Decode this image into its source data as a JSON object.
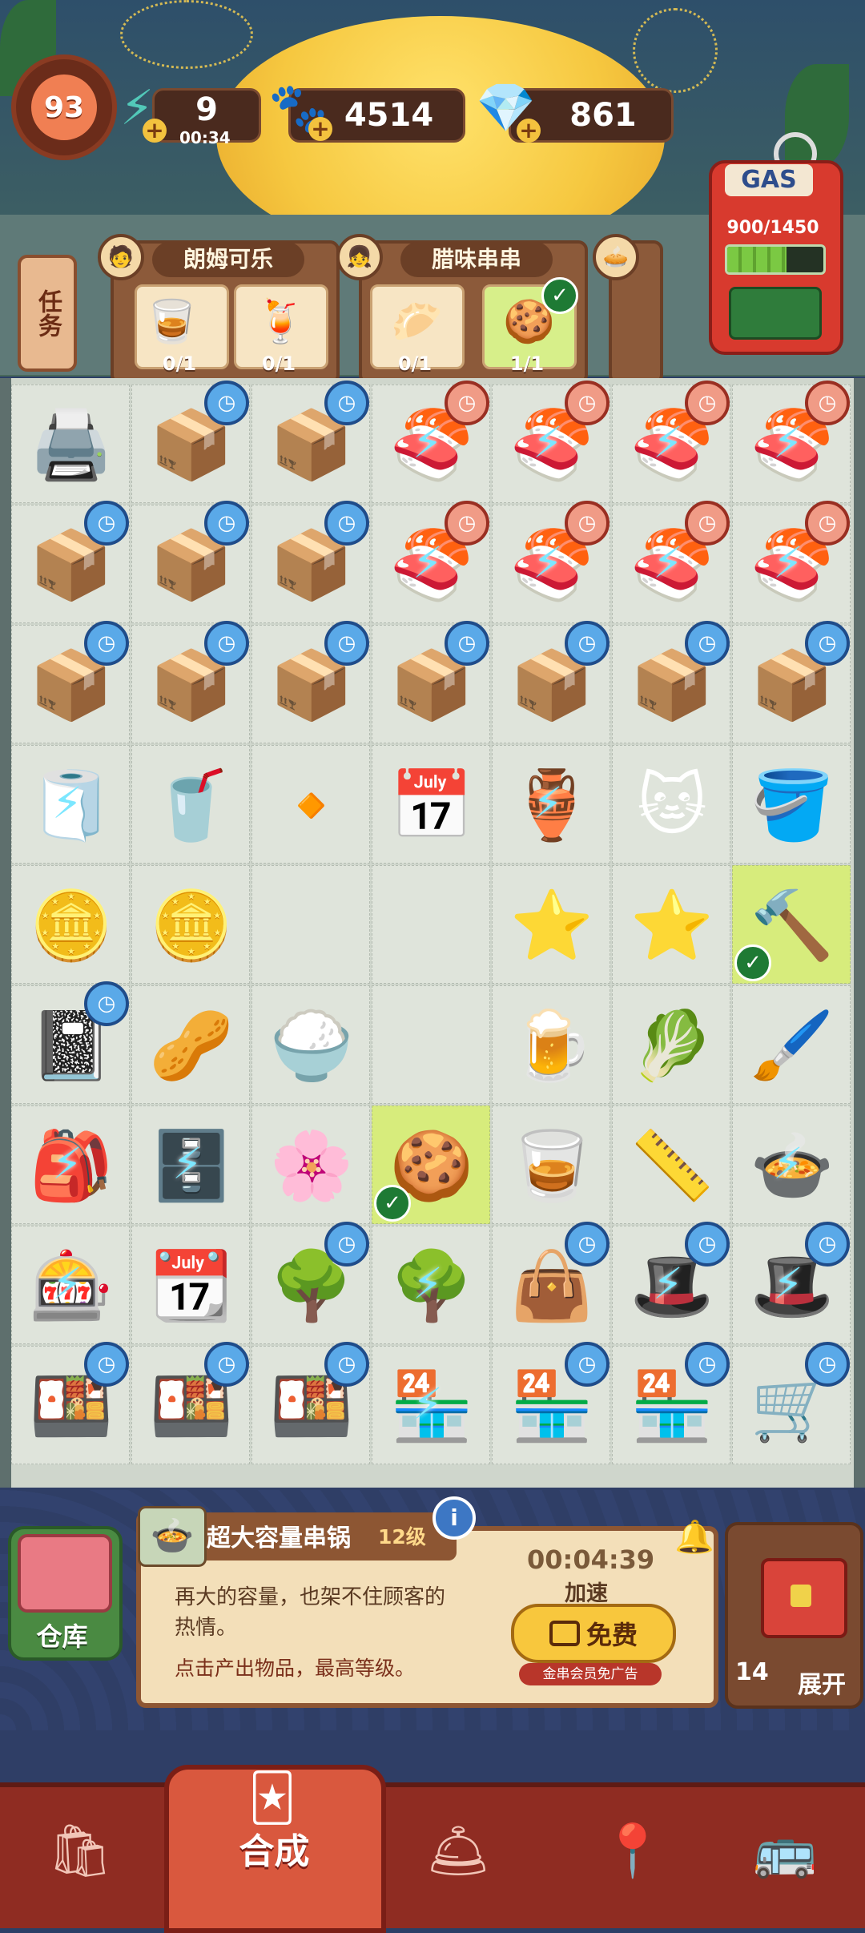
{
  "player": {
    "level": "93"
  },
  "resources": {
    "energy": {
      "value": "9",
      "timer": "00:34",
      "icon": "lightning-icon"
    },
    "paw_coins": {
      "value": "4514",
      "icon": "paw-icon"
    },
    "gems": {
      "value": "861",
      "icon": "diamond-icon"
    }
  },
  "gas": {
    "label": "GAS",
    "value": "900/1450",
    "fill_fraction": 0.62
  },
  "task_button": {
    "label": "任务"
  },
  "orders": [
    {
      "title": "朗姆可乐",
      "items": [
        {
          "icon": "🥃",
          "count": "0/1",
          "done": false
        },
        {
          "icon": "🍹",
          "count": "0/1",
          "done": false
        }
      ]
    },
    {
      "title": "腊味串串",
      "items": [
        {
          "icon": "🥟",
          "count": "0/1",
          "done": false
        },
        {
          "icon": "🍪",
          "count": "1/1",
          "done": true
        }
      ]
    }
  ],
  "board": {
    "rows": [
      [
        "🖨️",
        "📦",
        "📦",
        "🍣",
        "🍣",
        "🍣",
        "🍣"
      ],
      [
        "📦",
        "📦",
        "📦",
        "🍣",
        "🍣",
        "🍣",
        "🍣"
      ],
      [
        "📦",
        "📦",
        "📦",
        "📦",
        "📦",
        "📦",
        "📦"
      ],
      [
        "🧻",
        "🥤",
        "🔸",
        "📅",
        "🏺",
        "🐱",
        "🪣"
      ],
      [
        "🪙",
        "🪙",
        "",
        "",
        "⭐",
        "⭐",
        "🔨"
      ],
      [
        "📓",
        "🥜",
        "🍚",
        "",
        "🍺",
        "🥬",
        "🖌️"
      ],
      [
        "🎒",
        "🗄️",
        "🌸",
        "🍪",
        "🥃",
        "📏",
        "🍲"
      ],
      [
        "🎰",
        "📆",
        "🌳",
        "🌳",
        "👜",
        "🎩",
        "🎩"
      ],
      [
        "🍱",
        "🍱",
        "🍱",
        "🏪",
        "🏪",
        "🏪",
        "🛒"
      ]
    ]
  },
  "item_info": {
    "name": "超大容量串锅",
    "level": "12级",
    "description": "再大的容量，也架不住顾客的热情。",
    "hint": "点击产出物品，最高等级。",
    "timer": "00:04:39",
    "speed_label": "加速",
    "free_button": "免费",
    "free_note": "金串会员免广告"
  },
  "storage": {
    "label": "仓库"
  },
  "chest": {
    "count": "14",
    "expand_label": "展开"
  },
  "nav": {
    "items": [
      {
        "name": "shop-bag-icon",
        "icon": "🛍"
      },
      {
        "name": "merge-tab",
        "label": "合成"
      },
      {
        "name": "service-bell-icon",
        "icon": "🛎"
      },
      {
        "name": "map-pin-icon",
        "icon": "📍"
      },
      {
        "name": "bus-icon",
        "icon": "🚌"
      }
    ]
  }
}
